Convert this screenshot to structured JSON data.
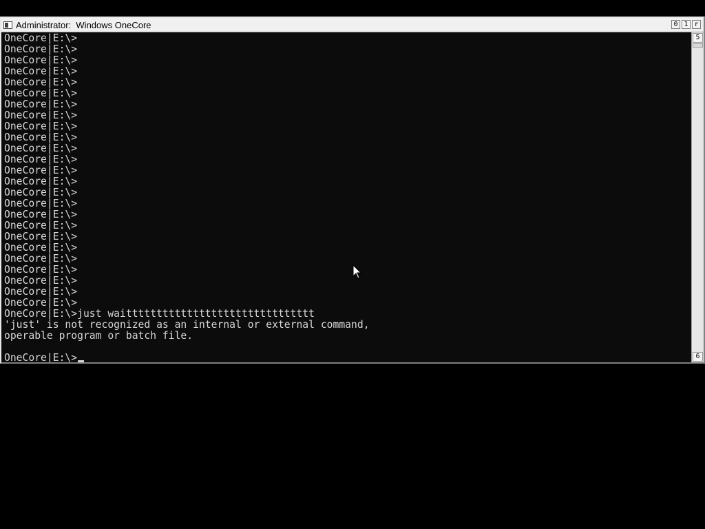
{
  "window": {
    "title": "Administrator:  Windows OneCore",
    "buttons": {
      "minimize": "0",
      "maximize": "1",
      "close": "r"
    }
  },
  "console": {
    "lines": [
      "OneCore|E:\\>",
      "OneCore|E:\\>",
      "OneCore|E:\\>",
      "OneCore|E:\\>",
      "OneCore|E:\\>",
      "OneCore|E:\\>",
      "OneCore|E:\\>",
      "OneCore|E:\\>",
      "OneCore|E:\\>",
      "OneCore|E:\\>",
      "OneCore|E:\\>",
      "OneCore|E:\\>",
      "OneCore|E:\\>",
      "OneCore|E:\\>",
      "OneCore|E:\\>",
      "OneCore|E:\\>",
      "OneCore|E:\\>",
      "OneCore|E:\\>",
      "OneCore|E:\\>",
      "OneCore|E:\\>",
      "OneCore|E:\\>",
      "OneCore|E:\\>",
      "OneCore|E:\\>",
      "OneCore|E:\\>",
      "OneCore|E:\\>",
      "OneCore|E:\\>just waittttttttttttttttttttttttttttttt",
      "'just' is not recognized as an internal or external command,",
      "operable program or batch file.",
      ""
    ],
    "prompt": "OneCore|E:\\>"
  },
  "scrollbar": {
    "up_glyph": "5",
    "down_glyph": "6"
  },
  "colors": {
    "console_bg": "#0c0c0c",
    "console_fg": "#d8d8d8",
    "titlebar_bg": "#f0f0f0"
  }
}
